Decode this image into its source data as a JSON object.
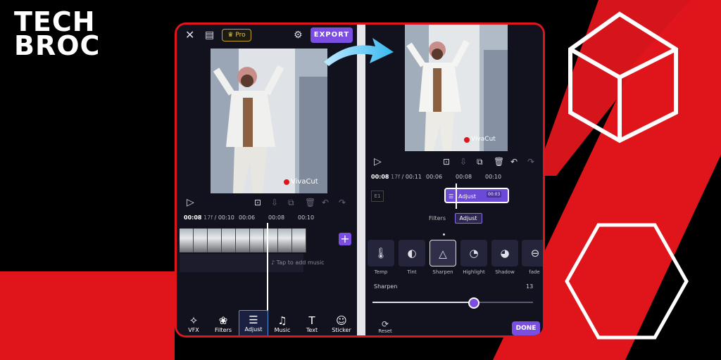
{
  "brand": {
    "line1": "TECH",
    "line2": "BROC"
  },
  "colors": {
    "accent": "#7a4ee0",
    "brand_red": "#e0151c",
    "pro_gold": "#c8a326"
  },
  "left_editor": {
    "pro_label": "Pro",
    "export_label": "EXPORT",
    "watermark": "VivaCut",
    "time_current": "00:08",
    "time_frame": "17f",
    "time_sep": "/",
    "time_total": "00:10",
    "ruler": [
      "00:06",
      "00:08",
      "00:10"
    ],
    "music_hint": "Tap to add music",
    "add_symbol": "+",
    "toolbar": [
      {
        "label": "VFX",
        "icon": "sparkle-icon",
        "glyph": "✧"
      },
      {
        "label": "Filters",
        "icon": "filters-icon",
        "glyph": "❀"
      },
      {
        "label": "Adjust",
        "icon": "sliders-icon",
        "glyph": "☰"
      },
      {
        "label": "Music",
        "icon": "music-icon",
        "glyph": "♫"
      },
      {
        "label": "Text",
        "icon": "text-icon",
        "glyph": "T"
      },
      {
        "label": "Sticker",
        "icon": "sticker-icon",
        "glyph": "☺"
      }
    ]
  },
  "right_editor": {
    "watermark": "VivaCut",
    "time_current": "00:08",
    "time_frame": "17f",
    "time_sep": "/",
    "time_total": "00:11",
    "ruler": [
      "00:06",
      "00:08",
      "00:10"
    ],
    "clip_label": "Adjust",
    "clip_badge": "00:03",
    "tabs": [
      "Filters",
      "Adjust"
    ],
    "active_tab": "Adjust",
    "adjust_items": [
      {
        "label": "Temp",
        "icon": "thermometer-icon",
        "glyph": "🌡"
      },
      {
        "label": "Tint",
        "icon": "tint-icon",
        "glyph": "◐"
      },
      {
        "label": "Sharpen",
        "icon": "triangle-icon",
        "glyph": "△"
      },
      {
        "label": "Highlight",
        "icon": "highlight-icon",
        "glyph": "◔"
      },
      {
        "label": "Shadow",
        "icon": "shadow-icon",
        "glyph": "◕"
      },
      {
        "label": "fade",
        "icon": "fade-icon",
        "glyph": "⊖"
      }
    ],
    "selected_adjust": "Sharpen",
    "slider_label": "Sharpen",
    "slider_value": "13",
    "slider_fraction": 0.63,
    "reset_label": "Reset",
    "done_label": "DONE"
  }
}
